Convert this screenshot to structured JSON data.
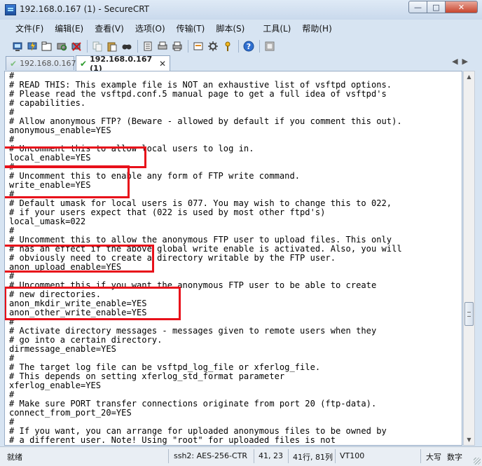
{
  "window": {
    "title": "192.168.0.167 (1) - SecureCRT"
  },
  "menu": [
    "文件(F)",
    "编辑(E)",
    "查看(V)",
    "选项(O)",
    "传输(T)",
    "脚本(S)",
    "工具(L)",
    "帮助(H)"
  ],
  "toolbar_icons": [
    "connect-icon",
    "quick-connect-icon",
    "connect-tab-icon",
    "reconnect-icon",
    "disconnect-icon",
    "copy-icon",
    "paste-icon",
    "find-icon",
    "print-setup-icon",
    "print-selection-icon",
    "print-icon",
    "session-options-icon",
    "global-options-icon",
    "keymap-icon",
    "help-icon",
    "sftp-icon"
  ],
  "tabs": [
    {
      "label": "192.168.0.167",
      "active": false
    },
    {
      "label": "192.168.0.167 (1)",
      "active": true
    }
  ],
  "terminal": {
    "lines": [
      "#",
      "# READ THIS: This example file is NOT an exhaustive list of vsftpd options.",
      "# Please read the vsftpd.conf.5 manual page to get a full idea of vsftpd's",
      "# capabilities.",
      "#",
      "# Allow anonymous FTP? (Beware - allowed by default if you comment this out).",
      "anonymous_enable=YES",
      "#",
      "# Uncomment this to allow local users to log in.",
      "local_enable=YES",
      "#",
      "# Uncomment this to enable any form of FTP write command.",
      "write_enable=YES",
      "#",
      "# Default umask for local users is 077. You may wish to change this to 022,",
      "# if your users expect that (022 is used by most other ftpd's)",
      "local_umask=022",
      "#",
      "# Uncomment this to allow the anonymous FTP user to upload files. This only",
      "# has an effect if the above global write enable is activated. Also, you will",
      "# obviously need to create a directory writable by the FTP user.",
      "anon_upload_enable=YES",
      "#",
      "# Uncomment this if you want the anonymous FTP user to be able to create",
      "# new directories.",
      "anon_mkdir_write_enable=YES",
      "anon_other_write_enable=YES",
      "#",
      "# Activate directory messages - messages given to remote users when they",
      "# go into a certain directory.",
      "dirmessage_enable=YES",
      "#",
      "# The target log file can be vsftpd_log_file or xferlog_file.",
      "# This depends on setting xferlog_std_format parameter",
      "xferlog_enable=YES",
      "#",
      "# Make sure PORT transfer connections originate from port 20 (ftp-data).",
      "connect_from_port_20=YES",
      "#",
      "# If you want, you can arrange for uploaded anonymous files to be owned by",
      "# a different user. Note! Using \"root\" for uploaded files is not"
    ]
  },
  "status": {
    "ready": "就绪",
    "protocol": "ssh2: AES-256-CTR",
    "cursor": "41, 23",
    "size": "41行, 81列",
    "terminal_type": "VT100",
    "caps": "大写",
    "num": "数字"
  },
  "colors": {
    "highlight": "#e8101a"
  }
}
